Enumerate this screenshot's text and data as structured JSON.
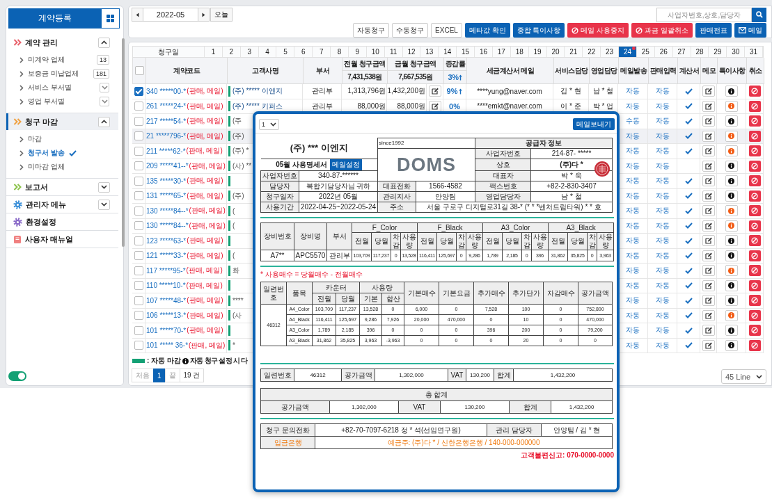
{
  "sidebar": {
    "register_button": "계약등록",
    "sections": [
      {
        "label": "계약 관리",
        "color": "#e8606a",
        "kind": "group",
        "expanded": true,
        "selected": false,
        "children": [
          {
            "label": "미계약 업체",
            "kind": "badge",
            "badge": "13",
            "selected": false
          },
          {
            "label": "보증금 미납업체",
            "kind": "badge",
            "badge": "181",
            "selected": false
          },
          {
            "label": "서비스 부서별",
            "kind": "dropdown",
            "selected": false
          },
          {
            "label": "영업 부서별",
            "kind": "dropdown",
            "selected": false
          }
        ]
      },
      {
        "label": "청구 마감",
        "color": "#f0a040",
        "kind": "group",
        "expanded": true,
        "selected": true,
        "children": [
          {
            "label": "마감",
            "kind": "link",
            "selected": false
          },
          {
            "label": "청구서 발송",
            "kind": "link",
            "selected": true
          },
          {
            "label": "미마감 업체",
            "kind": "link",
            "selected": false
          }
        ]
      },
      {
        "label": "보고서",
        "color": "#8bc34a",
        "kind": "group",
        "expanded": false,
        "selected": false
      },
      {
        "label": "관리자 메뉴",
        "color": "#3a8fd8",
        "kind": "group",
        "expanded": false,
        "selected": false
      },
      {
        "label": "환경설정",
        "color": "#8a6ac8",
        "kind": "link",
        "selected": false
      },
      {
        "label": "사용자 매뉴얼",
        "color": "#f08080",
        "kind": "link",
        "selected": false
      }
    ],
    "toggle": {
      "on": true
    }
  },
  "toolbar": {
    "month": "2022-05",
    "today_button": "오늘",
    "search": {
      "placeholder": "사업자번호,상호,담당자"
    },
    "actions": [
      {
        "label": "자동청구",
        "kind": "plain"
      },
      {
        "label": "수동청구",
        "kind": "plain"
      },
      {
        "label": "EXCEL",
        "kind": "plain"
      },
      {
        "label": "메타값 확인",
        "kind": "primary"
      },
      {
        "label": "종합 특이사항",
        "kind": "primary"
      },
      {
        "label": "메일 사용중지",
        "kind": "danger"
      },
      {
        "label": "과금 일괄취소",
        "kind": "danger"
      },
      {
        "label": "판매전표",
        "kind": "primary"
      },
      {
        "label": "메일",
        "kind": "primary"
      }
    ]
  },
  "contracts": {
    "day_label": "청구일",
    "days": [
      {
        "day": "1",
        "selected": false,
        "flagged": false
      },
      {
        "day": "2",
        "selected": false,
        "flagged": false
      },
      {
        "day": "3",
        "selected": false,
        "flagged": false
      },
      {
        "day": "4",
        "selected": false,
        "flagged": false
      },
      {
        "day": "5",
        "selected": false,
        "flagged": false
      },
      {
        "day": "6",
        "selected": false,
        "flagged": false
      },
      {
        "day": "7",
        "selected": false,
        "flagged": false
      },
      {
        "day": "8",
        "selected": false,
        "flagged": false
      },
      {
        "day": "9",
        "selected": false,
        "flagged": false
      },
      {
        "day": "10",
        "selected": false,
        "flagged": false
      },
      {
        "day": "11",
        "selected": false,
        "flagged": false
      },
      {
        "day": "12",
        "selected": false,
        "flagged": false
      },
      {
        "day": "13",
        "selected": false,
        "flagged": false
      },
      {
        "day": "14",
        "selected": false,
        "flagged": false
      },
      {
        "day": "15",
        "selected": false,
        "flagged": false
      },
      {
        "day": "16",
        "selected": false,
        "flagged": false
      },
      {
        "day": "17",
        "selected": false,
        "flagged": false
      },
      {
        "day": "18",
        "selected": false,
        "flagged": false
      },
      {
        "day": "19",
        "selected": false,
        "flagged": false
      },
      {
        "day": "20",
        "selected": false,
        "flagged": false
      },
      {
        "day": "21",
        "selected": false,
        "flagged": false
      },
      {
        "day": "22",
        "selected": false,
        "flagged": false
      },
      {
        "day": "23",
        "selected": false,
        "flagged": false
      },
      {
        "day": "24",
        "selected": true,
        "flagged": true
      },
      {
        "day": "25",
        "selected": false,
        "flagged": false
      },
      {
        "day": "26",
        "selected": false,
        "flagged": false
      },
      {
        "day": "27",
        "selected": false,
        "flagged": false
      },
      {
        "day": "28",
        "selected": false,
        "flagged": false
      },
      {
        "day": "29",
        "selected": false,
        "flagged": false
      },
      {
        "day": "30",
        "selected": false,
        "flagged": false
      },
      {
        "day": "31",
        "selected": false,
        "flagged": false
      }
    ],
    "select_all": {
      "checked": false
    },
    "columns": [
      "계약코드",
      "고객사명",
      "부서",
      "전월 청구금액",
      "금월 청구금액",
      "증감률",
      "세금계산서 메일",
      "서비스담당",
      "영업담당",
      "메일발송",
      "판매입력",
      "계산서",
      "메모",
      "특이사항",
      "취소"
    ],
    "totals": {
      "previous": "7,431,538원",
      "current": "7,667,535원",
      "change": "3%",
      "rising": true
    },
    "rows": [
      {
        "checked": true,
        "highlighted": false,
        "code": "340 *****00-*",
        "tags": "(판매, 메일)",
        "auto_close": true,
        "customer": "(주) ***** 이엔지",
        "dept": "관리부",
        "previous": "1,313,796원",
        "current": "1,432,200원",
        "change": "9%",
        "rising": true,
        "email": "****yung@naver.com",
        "service": "김 * 현",
        "sales": "남 * 철",
        "mail_send": "자동",
        "sale_input": "자동",
        "invoice": true,
        "note_alert": false
      },
      {
        "checked": false,
        "highlighted": false,
        "code": "261 *****24-*",
        "tags": "(판매, 메일)",
        "auto_close": true,
        "customer": "(주) ***** 키퍼스",
        "dept": "관리부",
        "previous": "88,000원",
        "current": "88,000원",
        "change": "0%",
        "rising": false,
        "email": "****emkt@naver.com",
        "service": "이 * 준",
        "sales": "박 * 업",
        "mail_send": "자동",
        "sale_input": "자동",
        "invoice": true,
        "note_alert": true
      },
      {
        "checked": false,
        "highlighted": false,
        "code": "217 *****54-*",
        "tags": "(판매, 메일)",
        "auto_close": true,
        "customer": "(주",
        "mail_send": "수동",
        "sale_input": "자동",
        "invoice": true,
        "note_alert": false
      },
      {
        "checked": false,
        "highlighted": true,
        "code": "21 *****796-*",
        "tags": "(판매, 메일)",
        "auto_close": true,
        "customer": "(주)",
        "mail_send": "자동",
        "sale_input": "자동",
        "invoice": true,
        "note_alert": true
      },
      {
        "checked": false,
        "highlighted": false,
        "code": "211 *****62-*",
        "tags": "(판매, 메일)",
        "auto_close": true,
        "customer": "(주) *",
        "mail_send": "자동",
        "sale_input": "자동",
        "invoice": true,
        "note_alert": true
      },
      {
        "checked": false,
        "highlighted": false,
        "code": "209 *****41--*",
        "tags": "(판매, 메일)",
        "auto_close": true,
        "customer": "(사) **",
        "mail_send": "자동",
        "sale_input": "자동",
        "invoice": false,
        "note_alert": false
      },
      {
        "checked": false,
        "highlighted": false,
        "code": "135 *****30-*",
        "tags": "(판매, 메일)",
        "auto_close": true,
        "mail_send": "자동",
        "sale_input": "자동",
        "invoice": true,
        "note_alert": false
      },
      {
        "checked": false,
        "highlighted": false,
        "code": "131 *****65-*",
        "tags": "(판매, 메일)",
        "auto_close": true,
        "customer": "(주)",
        "mail_send": "자동",
        "sale_input": "자동",
        "invoice": true,
        "note_alert": false
      },
      {
        "checked": false,
        "highlighted": false,
        "code": "130 *****84--*",
        "tags": "(판매, 메일)",
        "auto_close": true,
        "customer": "(",
        "mail_send": "자동",
        "sale_input": "자동",
        "invoice": true,
        "note_alert": true
      },
      {
        "checked": false,
        "highlighted": false,
        "code": "130 *****84--*",
        "tags": "(판매, 메일)",
        "auto_close": true,
        "customer": "(",
        "mail_send": "자동",
        "sale_input": "자동",
        "invoice": true,
        "note_alert": true
      },
      {
        "checked": false,
        "highlighted": false,
        "code": "123 *****63-*",
        "tags": "(판매, 메일)",
        "auto_close": true,
        "mail_send": "자동",
        "sale_input": "자동",
        "invoice": true,
        "note_alert": false
      },
      {
        "checked": false,
        "highlighted": false,
        "code": "121 *****33-*",
        "tags": "(판매, 메일)",
        "auto_close": true,
        "customer": "(",
        "mail_send": "자동",
        "sale_input": "자동",
        "invoice": true,
        "note_alert": false
      },
      {
        "checked": false,
        "highlighted": false,
        "code": "117 *****95-*",
        "tags": "(판매, 메일)",
        "auto_close": true,
        "customer": "화",
        "mail_send": "자동",
        "sale_input": "자동",
        "invoice": true,
        "note_alert": true
      },
      {
        "checked": false,
        "highlighted": false,
        "code": "110 *****10-*",
        "tags": "(판매, 메일)",
        "auto_close": true,
        "mail_send": "자동",
        "sale_input": "자동",
        "invoice": true,
        "note_alert": false
      },
      {
        "checked": false,
        "highlighted": false,
        "code": "107 *****48-*",
        "tags": "(판매, 메일)",
        "auto_close": true,
        "customer": "****",
        "mail_send": "자동",
        "sale_input": "자동",
        "invoice": true,
        "note_alert": false
      },
      {
        "checked": false,
        "highlighted": false,
        "code": "106 *****13-*",
        "tags": "(판매, 메일)",
        "auto_close": true,
        "customer": "(사",
        "mail_send": "자동",
        "sale_input": "자동",
        "invoice": true,
        "note_alert": true
      },
      {
        "checked": false,
        "highlighted": false,
        "code": "101 *****70-*",
        "tags": "(판매, 메일)",
        "auto_close": true,
        "mail_send": "자동",
        "sale_input": "자동",
        "invoice": true,
        "note_alert": false
      },
      {
        "checked": false,
        "highlighted": false,
        "code": "101 ***** 36-*",
        "tags": "(판매, 메일)",
        "auto_close": true,
        "customer": "*",
        "mail_send": "자동",
        "sale_input": "자동",
        "invoice": true,
        "note_alert": false
      }
    ],
    "legend": {
      "swatch_label": ": 자동 마감",
      "note": "자동 청구 설정 시 다"
    },
    "pagination": {
      "first": "처음",
      "pages": [
        {
          "label": "1",
          "selected": true
        }
      ],
      "last": "끝",
      "total": "19 건"
    },
    "page_size": "45 Line"
  },
  "statement": {
    "page_select": "1",
    "send_button": "메일보내기",
    "customer_title": "(주) *** 이엔지",
    "statement_title": "05월 사용명세서",
    "mail_settings_button": "메일설정",
    "since": "since1992",
    "logo": "DOMS",
    "supplier_title": "공급자 정보",
    "customer_fields": [
      {
        "label": "사업자번호",
        "value": "340-87-******"
      },
      {
        "label": "담당자",
        "value": "복합기담당자님 귀하"
      },
      {
        "label": "청구일자",
        "value": "2022년 05월"
      },
      {
        "label": "사용기간",
        "value": "2022-04-25~2022-05-24"
      }
    ],
    "office_fields": [
      {
        "label": "대표전화",
        "value": "1566-4582"
      },
      {
        "label": "관리지사",
        "value": "안양팀"
      },
      {
        "label": "주소",
        "value": "서울 구로구 디지털로31길 38-* (* * *벤처드림타워) * * 호"
      }
    ],
    "supplier_fields": [
      {
        "label": "사업자번호",
        "value": "214-87- *****"
      },
      {
        "label": "상호",
        "value": "(주)다 *"
      },
      {
        "label": "대표자",
        "value": "박 * 욱"
      },
      {
        "label": "팩스번호",
        "value": "+82-2-830-3407"
      },
      {
        "label": "영업담당자",
        "value": "남 * 철"
      }
    ],
    "equipment": {
      "headers": [
        "장비번호",
        "장비명",
        "부서"
      ],
      "groups": [
        {
          "name": "F_Color",
          "columns": [
            "전월",
            "당월",
            "차감",
            "사용량"
          ]
        },
        {
          "name": "F_Black",
          "columns": [
            "전월",
            "당월",
            "차감",
            "사용량"
          ]
        },
        {
          "name": "A3_Color",
          "columns": [
            "전월",
            "당월",
            "차감",
            "사용량"
          ]
        },
        {
          "name": "A3_Black",
          "columns": [
            "전월",
            "당월",
            "차감",
            "사용량"
          ]
        }
      ],
      "rows": [
        [
          "A7**",
          "APC5570",
          "관리부",
          "103,709",
          "117,237",
          "0",
          "13,528",
          "116,411",
          "125,697",
          "0",
          "9,286",
          "1,789",
          "2,185",
          "0",
          "396",
          "31,862",
          "35,825",
          "0",
          "3,963"
        ]
      ]
    },
    "formula_note": "* 사용매수 = 당월매수 - 전월매수",
    "billing": {
      "headers": {
        "serial": "일련번호",
        "item": "품목",
        "counter": "카운터",
        "counter_columns": [
          "전월",
          "당월"
        ],
        "usage": "사용량",
        "usage_columns": [
          "기본",
          "합산"
        ],
        "rest": [
          "기본매수",
          "기본요금",
          "추가매수",
          "추가단가",
          "차감매수",
          "공가금액"
        ]
      },
      "serial": "46312",
      "rows": [
        {
          "item": "A4_Color",
          "values": [
            "103,709",
            "117,237",
            "13,528",
            "0",
            "6,000",
            "0",
            "7,528",
            "100",
            "0",
            "752,800"
          ]
        },
        {
          "item": "A4_Black",
          "values": [
            "116,411",
            "125,697",
            "9,286",
            "7,926",
            "20,000",
            "470,000",
            "0",
            "10",
            "0",
            "470,000"
          ]
        },
        {
          "item": "A3_Color",
          "values": [
            "1,789",
            "2,185",
            "396",
            "0",
            "0",
            "0",
            "396",
            "200",
            "0",
            "79,200"
          ]
        },
        {
          "item": "A3_Black",
          "values": [
            "31,862",
            "35,825",
            "3,963",
            "-3,963",
            "0",
            "0",
            "0",
            "20",
            "0",
            "0"
          ]
        }
      ]
    },
    "summary": [
      {
        "label": "일련번호",
        "value": "46312"
      },
      {
        "label": "공가금액",
        "value": "1,302,000"
      },
      {
        "label": "VAT",
        "value": "130,200"
      },
      {
        "label": "합계",
        "value": "1,432,200"
      }
    ],
    "grand_total": {
      "title": "총 합계",
      "items": [
        {
          "label": "공가금액",
          "value": "1,302,000"
        },
        {
          "label": "VAT",
          "value": "130,200"
        },
        {
          "label": "합계",
          "value": "1,432,200"
        }
      ]
    },
    "contact": {
      "phone_label": "청구 문의전화",
      "phone": "+82-70-7097-6218 정 * 석(선임연구원)",
      "manager_label": "관리 담당자",
      "manager": "안양팀 / 김 * 현",
      "bank_label": "입금은행",
      "bank": "예금주: (주)다 * / 신한은행은행 / 140-000-000000"
    },
    "complaint": "고객불편신고: 070-0000-0000"
  }
}
